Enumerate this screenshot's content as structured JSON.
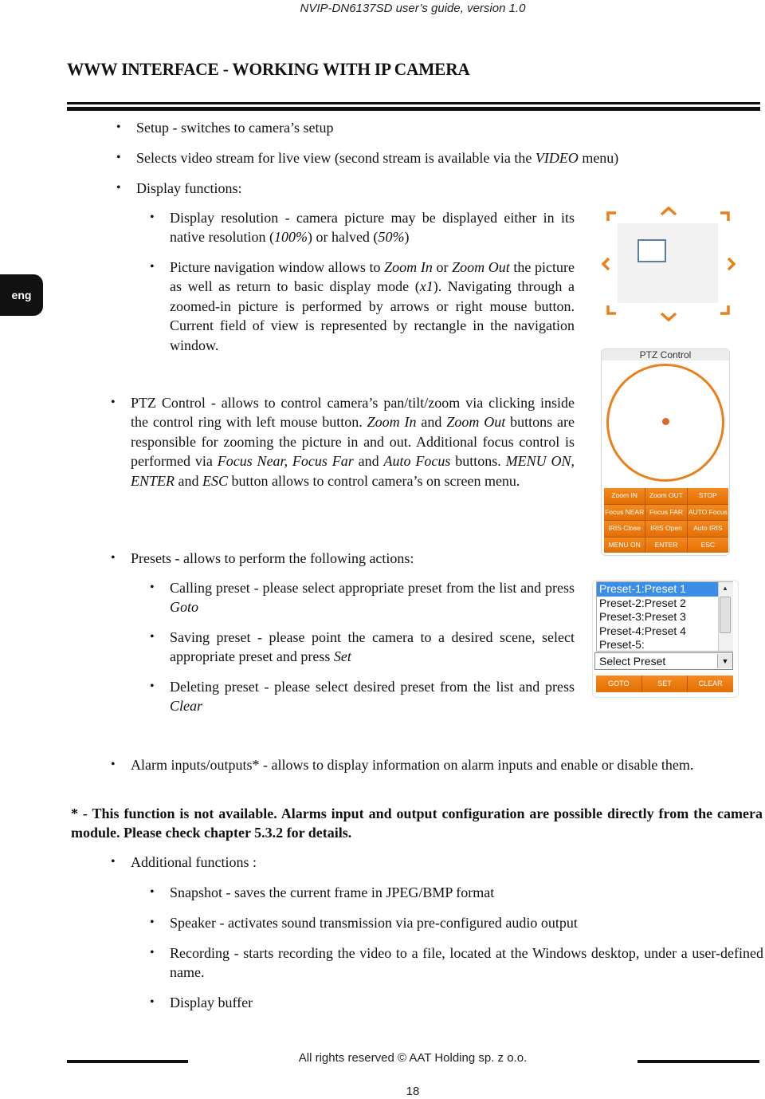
{
  "header": {
    "doc_title": "NVIP-DN6137SD user’s guide, version 1.0"
  },
  "section_title": "WWW INTERFACE - WORKING WITH IP CAMERA",
  "side_tab": {
    "label": "eng"
  },
  "bullets": {
    "setup": "Setup - switches to camera’s setup",
    "stream_a": "Selects video stream for live view (second stream is available via the ",
    "stream_i": "VIDEO",
    "stream_b": " menu)",
    "display": "Display functions:",
    "res_a": "Display resolution - camera picture may be displayed either in its native resolution (",
    "res_i1": "100%",
    "res_b": ") or halved (",
    "res_i2": "50%",
    "res_c": ")",
    "nav_a": "Picture navigation window allows to ",
    "nav_i1": "Zoom In",
    "nav_b": " or ",
    "nav_i2": "Zoom Out",
    "nav_c": " the picture as well as return to basic display mode (",
    "nav_i3": "x1",
    "nav_d": "). Navigating through a zoomed-in picture is performed by arrows or right mouse button. Current field of view is represented by rectangle in the navigation window.",
    "ptz_a": "PTZ Control - allows to control camera’s pan/tilt/zoom via clicking inside the control ring with left mouse button. ",
    "ptz_i1": "Zoom In",
    "ptz_b": " and  ",
    "ptz_i2": "Zoom Out",
    "ptz_c": " buttons are responsible for zooming the picture in and out. Additional focus control is performed via ",
    "ptz_i3": "Focus Near, Focus Far",
    "ptz_d": " and ",
    "ptz_i4": "Auto Focus",
    "ptz_e": " buttons. ",
    "ptz_i5": "MENU ON, ENTER",
    "ptz_f": " and ",
    "ptz_i6": "ESC",
    "ptz_g": " button allows to control camera’s on screen menu.",
    "presets": "Presets - allows to perform the following actions:",
    "call_a": "Calling preset - please select appropriate preset from the list and press ",
    "call_i": "Goto",
    "save_a": "Saving preset - please point the camera to a desired scene, select appropriate preset and press ",
    "save_i": "Set",
    "del_a": "Deleting preset - please select desired preset from the list and press ",
    "del_i": "Clear",
    "alarm": "Alarm inputs/outputs* - allows to display information on alarm inputs and enable or disable them.",
    "note": "* - This function is not available. Alarms input and output configuration are possible directly from the camera module. Please check chapter 5.3.2 for details.",
    "additional": "Additional functions :",
    "snapshot": "Snapshot - saves the current frame in JPEG/BMP format",
    "speaker": "Speaker - activates sound transmission via pre-configured audio output",
    "recording": "Recording - starts recording the video to a file, located at the Windows desktop, under a  user-defined name.",
    "buffer": "Display buffer"
  },
  "ptz_panel": {
    "title": "PTZ Control",
    "buttons": [
      "Zoom IN",
      "Zoom OUT",
      "STOP",
      "Focus NEAR",
      "Focus FAR",
      "AUTO Focus",
      "IRIS Close",
      "IRIS Open",
      "Auto IRIS",
      "MENU ON",
      "ENTER",
      "ESC"
    ],
    "accent": "#e8801b"
  },
  "preset_panel": {
    "items": [
      "Preset-1:Preset 1",
      "Preset-2:Preset 2",
      "Preset-3:Preset 3",
      "Preset-4:Preset 4",
      "Preset-5:"
    ],
    "selected": "Preset-1:Preset 1",
    "select_value": "Select Preset",
    "buttons": [
      "GOTO",
      "SET",
      "CLEAR"
    ]
  },
  "footer": {
    "copyright": "All rights reserved © AAT Holding sp. z o.o.",
    "page_number": "18"
  }
}
